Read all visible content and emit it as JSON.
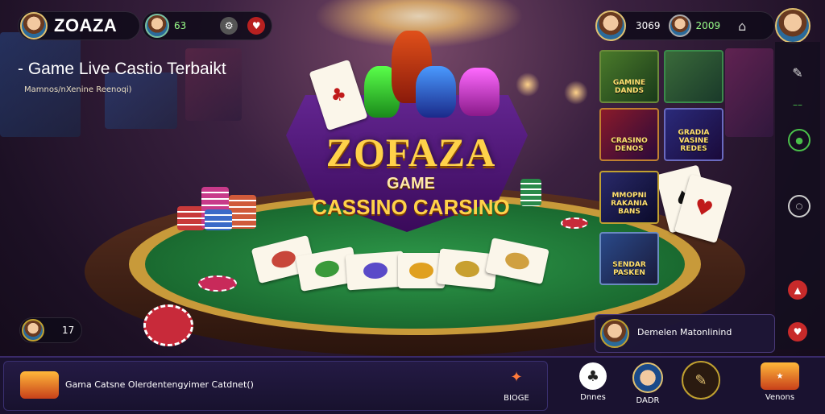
{
  "top_bar": {
    "brand": "ZOAZA",
    "left_balance": "63",
    "right_balance_1": "3069",
    "right_balance_2": "2009"
  },
  "headline": {
    "title": "- Game Live Castio Terbaikt",
    "subtitle": "Mamnos/nXenine Reenoqi)"
  },
  "logo": {
    "main": "ZOFAZA",
    "game": "GAME",
    "sub": "CASSINO CARSINO"
  },
  "game_tiles": [
    {
      "label": "GAMINE\nDANDS",
      "colors": [
        "#4a7a2a",
        "#1a3a1a"
      ]
    },
    {
      "label": "",
      "colors": [
        "#3a6a3a",
        "#1a3a2a"
      ]
    },
    {
      "label": "CRASINO\nDENOS",
      "colors": [
        "#8a1a2a",
        "#2a0a3a"
      ]
    },
    {
      "label": "GRADIA\nVASINE\nREDES",
      "colors": [
        "#2a2a7a",
        "#1a0a3a"
      ]
    },
    {
      "label": "MMOPNI\nRAKANIA\nBANS",
      "colors": [
        "#2a2a6a",
        "#0a0a2a"
      ]
    },
    {
      "label": "SENDAR\nPASKEN",
      "colors": [
        "#2a4a8a",
        "#1a1a3a"
      ]
    }
  ],
  "left_small_badge": "17",
  "toast": {
    "text": "Demelen Matonlinind"
  },
  "news_bar": {
    "text": "Gama  Catsne Olerdentengyimer Catdnet()"
  },
  "bottom_nav": [
    {
      "label": "BIOGE",
      "icon": "flame-icon"
    },
    {
      "label": "Dnnes",
      "icon": "cards-icon"
    },
    {
      "label": "DADR",
      "icon": "avatar-icon"
    },
    {
      "label": "",
      "icon": "edit-icon"
    },
    {
      "label": "Venons",
      "icon": "logo-icon"
    }
  ],
  "colors": {
    "accent_gold": "#ffd24a",
    "felt_green": "#2e9a4a",
    "panel_dark": "#1a1230"
  }
}
